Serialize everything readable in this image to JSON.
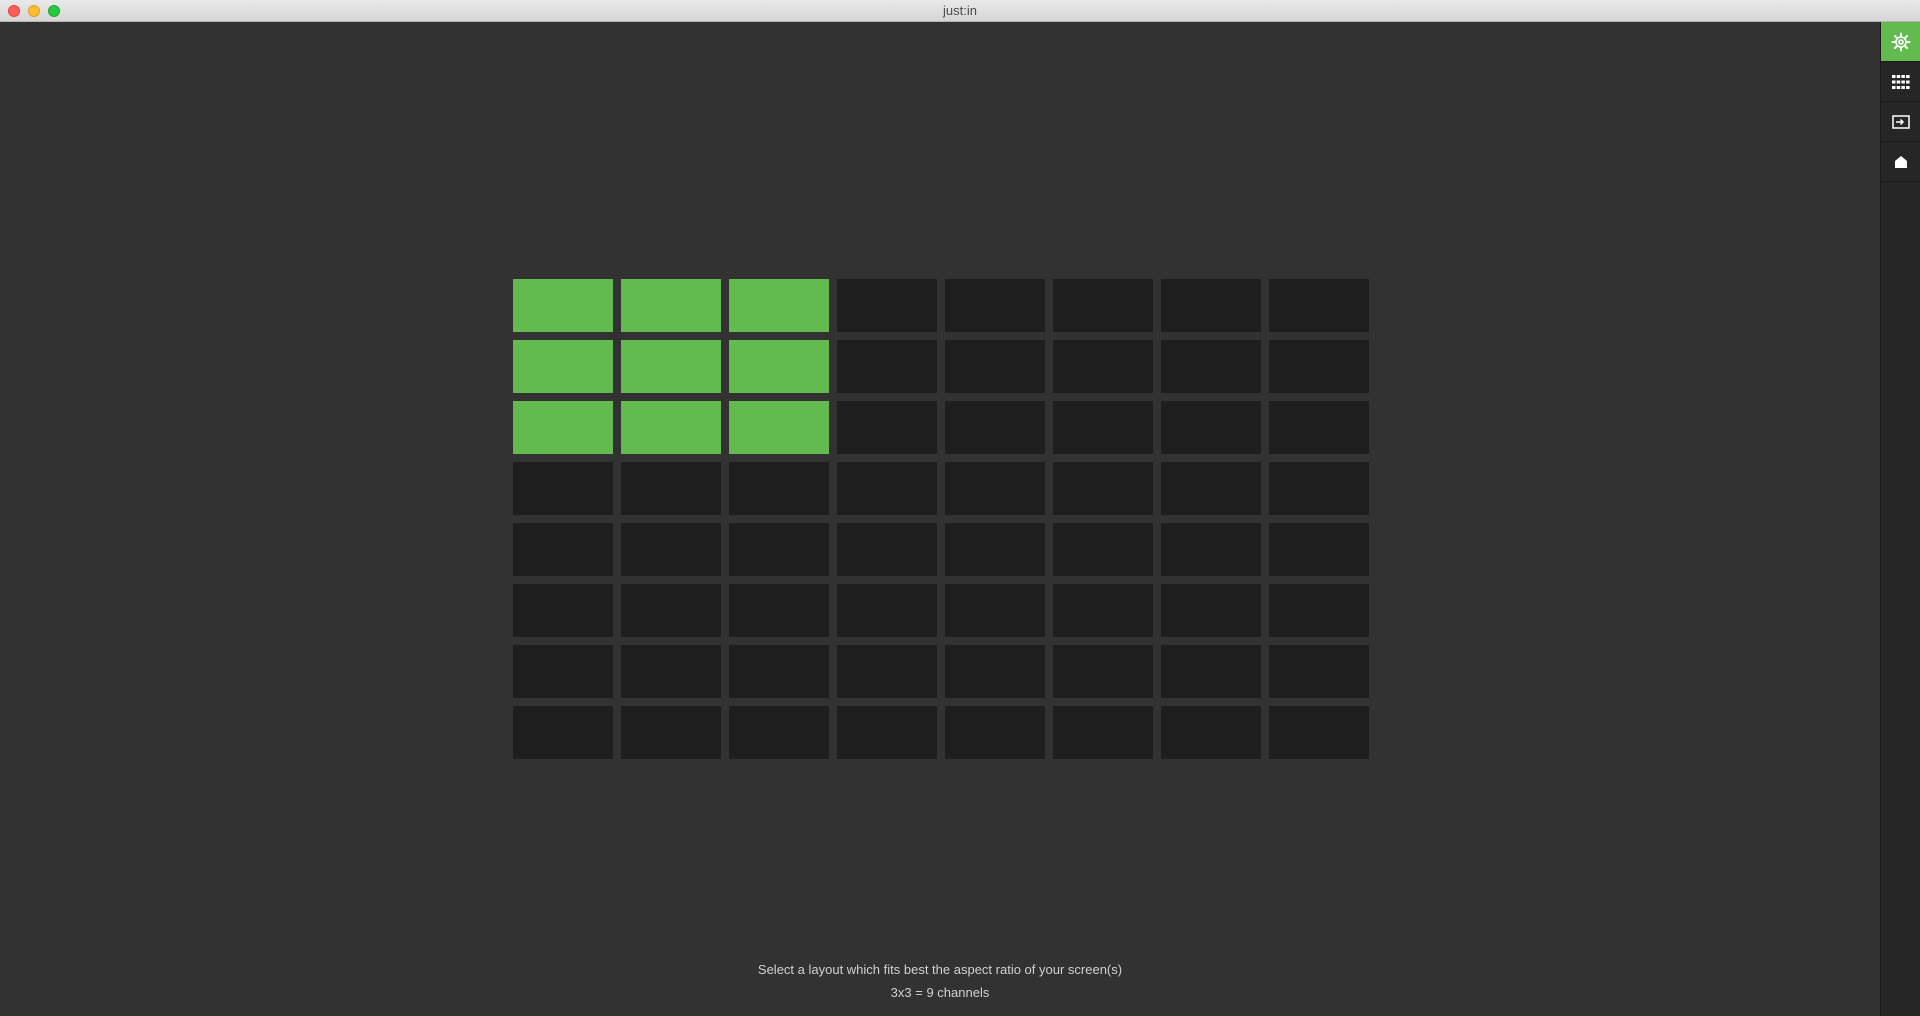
{
  "window": {
    "title": "just:in"
  },
  "sidebar": {
    "items": [
      {
        "icon": "gear-icon",
        "active": true
      },
      {
        "icon": "grid-icon",
        "active": false
      },
      {
        "icon": "input-icon",
        "active": false
      },
      {
        "icon": "home-icon",
        "active": false
      }
    ]
  },
  "layout": {
    "columns": 8,
    "rows": 8,
    "selected_columns": 3,
    "selected_rows": 3
  },
  "footer": {
    "instruction": "Select a layout which fits best the aspect ratio of your screen(s)",
    "summary": "3x3 = 9 channels"
  },
  "colors": {
    "accent": "#63bb4f",
    "cell": "#1e1e1e",
    "background": "#323232"
  }
}
